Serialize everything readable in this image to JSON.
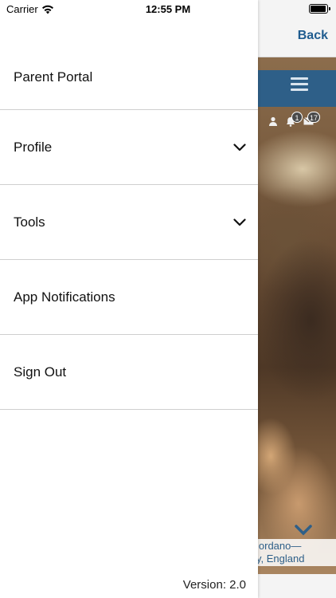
{
  "status_bar": {
    "carrier": "Carrier",
    "time": "12:55 PM"
  },
  "background_app": {
    "back_label": "Back",
    "notification_count": "1",
    "message_count": "17",
    "caption_line1": "iordano—",
    "caption_line2": "y, England",
    "accent_color": "#2e5f88"
  },
  "drawer": {
    "items": [
      {
        "label": "Parent Portal",
        "has_chevron": false
      },
      {
        "label": "Profile",
        "has_chevron": true
      },
      {
        "label": "Tools",
        "has_chevron": true
      },
      {
        "label": "App Notifications",
        "has_chevron": false
      },
      {
        "label": "Sign Out",
        "has_chevron": false
      }
    ],
    "version": "Version: 2.0"
  },
  "icons": {
    "wifi": "wifi-icon",
    "battery": "battery-icon",
    "chevron": "chevron-down-icon",
    "hamburger": "hamburger-menu-icon",
    "user": "user-icon",
    "bell": "bell-icon",
    "mail": "mail-icon"
  }
}
